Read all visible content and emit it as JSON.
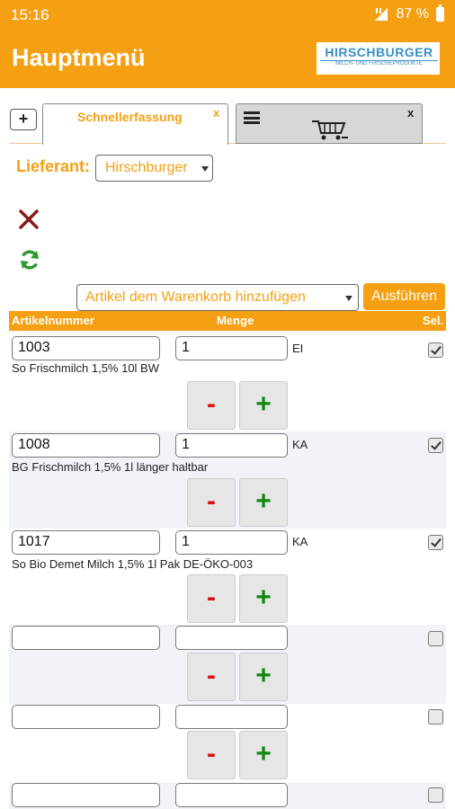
{
  "status_bar": {
    "time": "15:16",
    "battery": "87 %"
  },
  "header": {
    "title": "Hauptmenü",
    "logo_text": "HIRSCHBURGER",
    "logo_subtext": "MILCH- UND FRISCHEPRODUKTE"
  },
  "tabs": {
    "add_label": "+",
    "active_label": "Schnellerfassung",
    "close_label": "x"
  },
  "supplier": {
    "label": "Lieferant:",
    "value": "Hirschburger"
  },
  "action": {
    "select_value": "Artikel dem Warenkorb hinzufügen",
    "run_label": "Ausführen"
  },
  "table": {
    "headers": {
      "article": "Artikelnummer",
      "quantity": "Menge",
      "select": "Sel."
    },
    "minus_label": "-",
    "plus_label": "+",
    "rows": [
      {
        "article": "1003",
        "quantity": "1",
        "unit": "EI",
        "description": "So Frischmilch 1,5% 10l BW",
        "selected": true
      },
      {
        "article": "1008",
        "quantity": "1",
        "unit": "KA",
        "description": "BG Frischmilch 1,5% 1l länger haltbar",
        "selected": true
      },
      {
        "article": "1017",
        "quantity": "1",
        "unit": "KA",
        "description": "So Bio Demet Milch 1,5% 1l Pak DE-ÖKO-003",
        "selected": true
      },
      {
        "article": "",
        "quantity": "",
        "unit": "",
        "description": "",
        "selected": false
      },
      {
        "article": "",
        "quantity": "",
        "unit": "",
        "description": "",
        "selected": false
      },
      {
        "article": "",
        "quantity": "",
        "unit": "",
        "description": "",
        "selected": false
      }
    ]
  },
  "colors": {
    "accent": "#f4a012",
    "delete": "#8b1a1a",
    "refresh": "#2a9a2a",
    "minus": "#dd1111",
    "plus": "#118811"
  }
}
